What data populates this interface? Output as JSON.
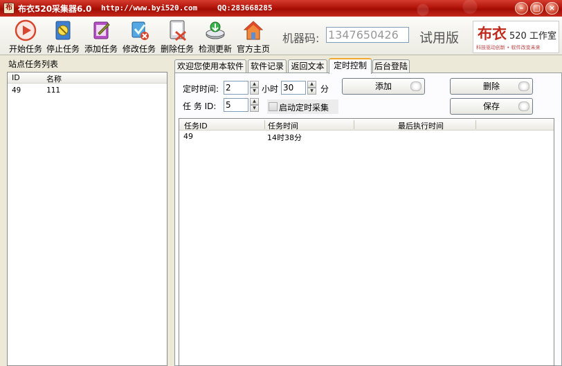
{
  "window": {
    "title": "布衣520采集器6.0",
    "url": "http://www.byi520.com",
    "qq": "QQ:283668285"
  },
  "toolbar": {
    "buttons": [
      {
        "label": "开始任务",
        "icon": "play-icon"
      },
      {
        "label": "停止任务",
        "icon": "stop-icon"
      },
      {
        "label": "添加任务",
        "icon": "add-task-icon"
      },
      {
        "label": "修改任务",
        "icon": "edit-task-icon"
      },
      {
        "label": "删除任务",
        "icon": "delete-task-icon"
      },
      {
        "label": "检测更新",
        "icon": "update-icon"
      },
      {
        "label": "官方主页",
        "icon": "home-icon"
      }
    ],
    "machine_label": "机器码:",
    "machine_code": "1347650426",
    "trial_label": "试用版",
    "brand": {
      "name": "布衣",
      "studio": "520 工作室",
      "slogan": "科技驱动创新 • 软件改变未来"
    }
  },
  "left_panel": {
    "title": "站点任务列表",
    "columns": [
      "ID",
      "名称"
    ],
    "rows": [
      {
        "id": "49",
        "name": "111"
      }
    ]
  },
  "tabs": [
    "欢迎您使用本软件",
    "软件记录",
    "返回文本",
    "定时控制",
    "后台登陆"
  ],
  "active_tab": "定时控制",
  "timer": {
    "time_label": "定时时间:",
    "hour_value": "2",
    "hour_unit": "小时",
    "minute_value": "30",
    "minute_unit": "分",
    "task_id_label": "任 务 ID:",
    "task_id_value": "5",
    "enable_label": "启动定时采集",
    "add_button": "添加",
    "delete_button": "删除",
    "save_button": "保存"
  },
  "schedule_table": {
    "columns": [
      "任务ID",
      "任务时间",
      "最后执行时间"
    ],
    "rows": [
      {
        "task_id": "49",
        "task_time": "14时38分",
        "last_run": ""
      }
    ]
  },
  "colors": {
    "titlebar": "#b3140a",
    "accent_tab": "#f1a830",
    "brand_red": "#c0281b"
  }
}
